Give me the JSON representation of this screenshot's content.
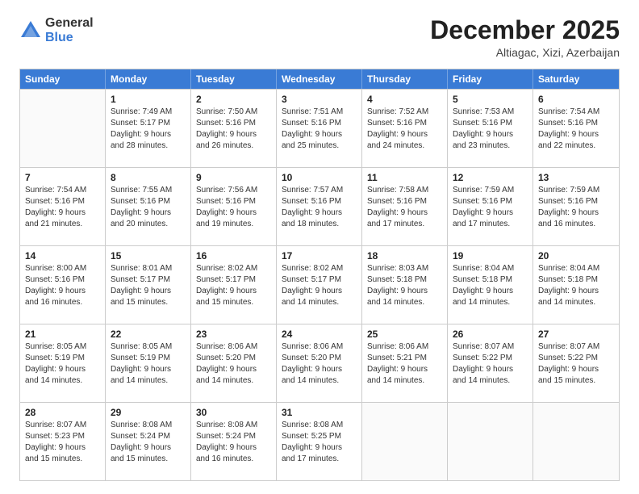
{
  "logo": {
    "general": "General",
    "blue": "Blue"
  },
  "header": {
    "month": "December 2025",
    "location": "Altiagac, Xizi, Azerbaijan"
  },
  "weekdays": [
    "Sunday",
    "Monday",
    "Tuesday",
    "Wednesday",
    "Thursday",
    "Friday",
    "Saturday"
  ],
  "rows": [
    [
      {
        "day": "",
        "sunrise": "",
        "sunset": "",
        "daylight": ""
      },
      {
        "day": "1",
        "sunrise": "Sunrise: 7:49 AM",
        "sunset": "Sunset: 5:17 PM",
        "daylight": "Daylight: 9 hours and 28 minutes."
      },
      {
        "day": "2",
        "sunrise": "Sunrise: 7:50 AM",
        "sunset": "Sunset: 5:16 PM",
        "daylight": "Daylight: 9 hours and 26 minutes."
      },
      {
        "day": "3",
        "sunrise": "Sunrise: 7:51 AM",
        "sunset": "Sunset: 5:16 PM",
        "daylight": "Daylight: 9 hours and 25 minutes."
      },
      {
        "day": "4",
        "sunrise": "Sunrise: 7:52 AM",
        "sunset": "Sunset: 5:16 PM",
        "daylight": "Daylight: 9 hours and 24 minutes."
      },
      {
        "day": "5",
        "sunrise": "Sunrise: 7:53 AM",
        "sunset": "Sunset: 5:16 PM",
        "daylight": "Daylight: 9 hours and 23 minutes."
      },
      {
        "day": "6",
        "sunrise": "Sunrise: 7:54 AM",
        "sunset": "Sunset: 5:16 PM",
        "daylight": "Daylight: 9 hours and 22 minutes."
      }
    ],
    [
      {
        "day": "7",
        "sunrise": "Sunrise: 7:54 AM",
        "sunset": "Sunset: 5:16 PM",
        "daylight": "Daylight: 9 hours and 21 minutes."
      },
      {
        "day": "8",
        "sunrise": "Sunrise: 7:55 AM",
        "sunset": "Sunset: 5:16 PM",
        "daylight": "Daylight: 9 hours and 20 minutes."
      },
      {
        "day": "9",
        "sunrise": "Sunrise: 7:56 AM",
        "sunset": "Sunset: 5:16 PM",
        "daylight": "Daylight: 9 hours and 19 minutes."
      },
      {
        "day": "10",
        "sunrise": "Sunrise: 7:57 AM",
        "sunset": "Sunset: 5:16 PM",
        "daylight": "Daylight: 9 hours and 18 minutes."
      },
      {
        "day": "11",
        "sunrise": "Sunrise: 7:58 AM",
        "sunset": "Sunset: 5:16 PM",
        "daylight": "Daylight: 9 hours and 17 minutes."
      },
      {
        "day": "12",
        "sunrise": "Sunrise: 7:59 AM",
        "sunset": "Sunset: 5:16 PM",
        "daylight": "Daylight: 9 hours and 17 minutes."
      },
      {
        "day": "13",
        "sunrise": "Sunrise: 7:59 AM",
        "sunset": "Sunset: 5:16 PM",
        "daylight": "Daylight: 9 hours and 16 minutes."
      }
    ],
    [
      {
        "day": "14",
        "sunrise": "Sunrise: 8:00 AM",
        "sunset": "Sunset: 5:16 PM",
        "daylight": "Daylight: 9 hours and 16 minutes."
      },
      {
        "day": "15",
        "sunrise": "Sunrise: 8:01 AM",
        "sunset": "Sunset: 5:17 PM",
        "daylight": "Daylight: 9 hours and 15 minutes."
      },
      {
        "day": "16",
        "sunrise": "Sunrise: 8:02 AM",
        "sunset": "Sunset: 5:17 PM",
        "daylight": "Daylight: 9 hours and 15 minutes."
      },
      {
        "day": "17",
        "sunrise": "Sunrise: 8:02 AM",
        "sunset": "Sunset: 5:17 PM",
        "daylight": "Daylight: 9 hours and 14 minutes."
      },
      {
        "day": "18",
        "sunrise": "Sunrise: 8:03 AM",
        "sunset": "Sunset: 5:18 PM",
        "daylight": "Daylight: 9 hours and 14 minutes."
      },
      {
        "day": "19",
        "sunrise": "Sunrise: 8:04 AM",
        "sunset": "Sunset: 5:18 PM",
        "daylight": "Daylight: 9 hours and 14 minutes."
      },
      {
        "day": "20",
        "sunrise": "Sunrise: 8:04 AM",
        "sunset": "Sunset: 5:18 PM",
        "daylight": "Daylight: 9 hours and 14 minutes."
      }
    ],
    [
      {
        "day": "21",
        "sunrise": "Sunrise: 8:05 AM",
        "sunset": "Sunset: 5:19 PM",
        "daylight": "Daylight: 9 hours and 14 minutes."
      },
      {
        "day": "22",
        "sunrise": "Sunrise: 8:05 AM",
        "sunset": "Sunset: 5:19 PM",
        "daylight": "Daylight: 9 hours and 14 minutes."
      },
      {
        "day": "23",
        "sunrise": "Sunrise: 8:06 AM",
        "sunset": "Sunset: 5:20 PM",
        "daylight": "Daylight: 9 hours and 14 minutes."
      },
      {
        "day": "24",
        "sunrise": "Sunrise: 8:06 AM",
        "sunset": "Sunset: 5:20 PM",
        "daylight": "Daylight: 9 hours and 14 minutes."
      },
      {
        "day": "25",
        "sunrise": "Sunrise: 8:06 AM",
        "sunset": "Sunset: 5:21 PM",
        "daylight": "Daylight: 9 hours and 14 minutes."
      },
      {
        "day": "26",
        "sunrise": "Sunrise: 8:07 AM",
        "sunset": "Sunset: 5:22 PM",
        "daylight": "Daylight: 9 hours and 14 minutes."
      },
      {
        "day": "27",
        "sunrise": "Sunrise: 8:07 AM",
        "sunset": "Sunset: 5:22 PM",
        "daylight": "Daylight: 9 hours and 15 minutes."
      }
    ],
    [
      {
        "day": "28",
        "sunrise": "Sunrise: 8:07 AM",
        "sunset": "Sunset: 5:23 PM",
        "daylight": "Daylight: 9 hours and 15 minutes."
      },
      {
        "day": "29",
        "sunrise": "Sunrise: 8:08 AM",
        "sunset": "Sunset: 5:24 PM",
        "daylight": "Daylight: 9 hours and 15 minutes."
      },
      {
        "day": "30",
        "sunrise": "Sunrise: 8:08 AM",
        "sunset": "Sunset: 5:24 PM",
        "daylight": "Daylight: 9 hours and 16 minutes."
      },
      {
        "day": "31",
        "sunrise": "Sunrise: 8:08 AM",
        "sunset": "Sunset: 5:25 PM",
        "daylight": "Daylight: 9 hours and 17 minutes."
      },
      {
        "day": "",
        "sunrise": "",
        "sunset": "",
        "daylight": ""
      },
      {
        "day": "",
        "sunrise": "",
        "sunset": "",
        "daylight": ""
      },
      {
        "day": "",
        "sunrise": "",
        "sunset": "",
        "daylight": ""
      }
    ]
  ]
}
